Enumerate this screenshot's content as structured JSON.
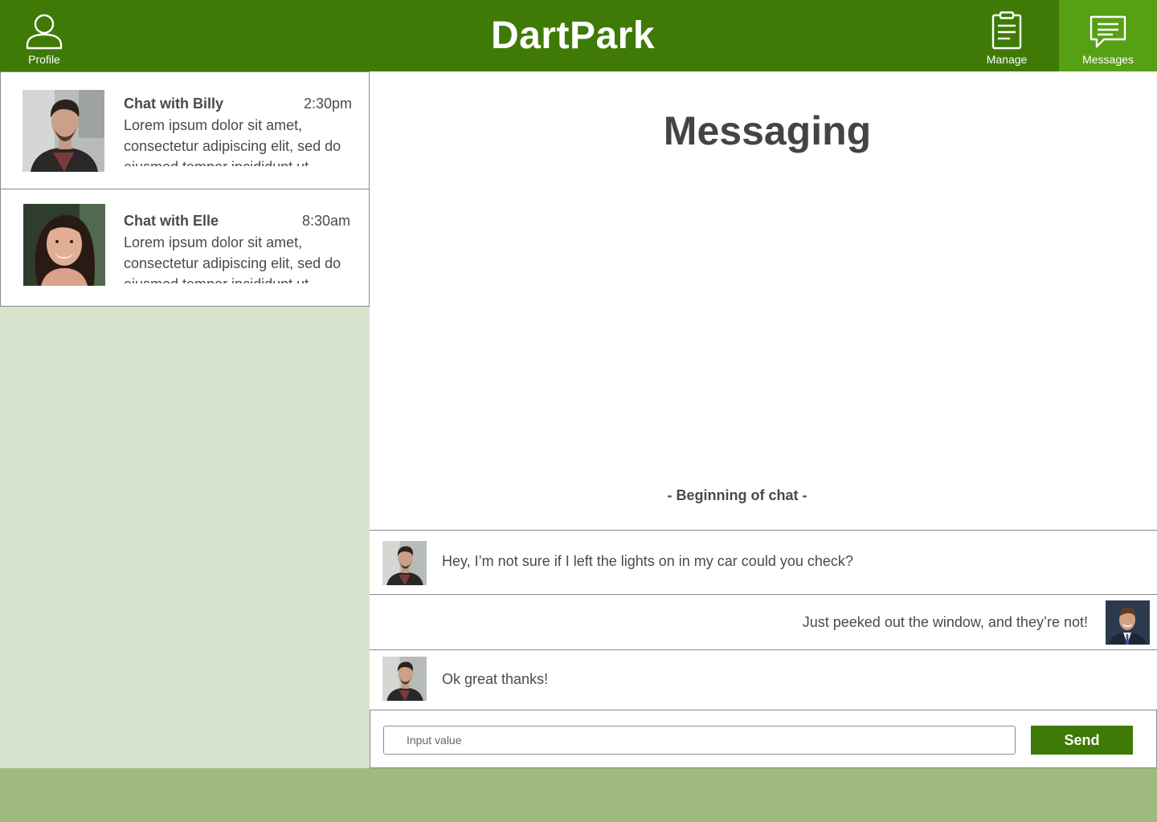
{
  "header": {
    "brand": "DartPark",
    "nav": {
      "profile": {
        "label": "Profile",
        "icon": "person-icon"
      },
      "manage": {
        "label": "Manage",
        "icon": "clipboard-icon"
      },
      "messages": {
        "label": "Messages",
        "icon": "chat-bubble-icon",
        "active": true
      }
    },
    "colors": {
      "bar": "#3f7a06",
      "active": "#56a014"
    }
  },
  "sidebar": {
    "chats": [
      {
        "title": "Chat with Billy",
        "time": "2:30pm",
        "preview": "Lorem ipsum dolor sit amet, consectetur adipiscing elit, sed do eiusmod tempor incididunt ut"
      },
      {
        "title": "Chat with Elle",
        "time": "8:30am",
        "preview": "Lorem ipsum dolor sit amet, consectetur adipiscing elit, sed do eiusmod tempor incididunt ut"
      }
    ]
  },
  "main": {
    "title": "Messaging",
    "chat_start": "- Beginning of chat -",
    "messages": [
      {
        "from": "other",
        "text": "Hey, I’m not sure if I left the lights on in my car could you check?"
      },
      {
        "from": "me",
        "text": "Just peeked out the window, and they’re not!"
      },
      {
        "from": "other",
        "text": "Ok great thanks!"
      }
    ],
    "composer": {
      "placeholder": "Input value",
      "send_label": "Send"
    }
  }
}
